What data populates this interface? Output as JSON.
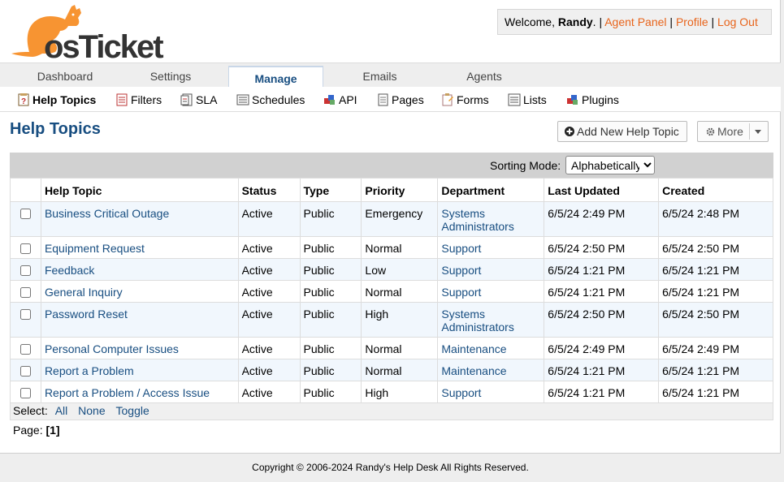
{
  "header": {
    "logo_text": "osTicket",
    "welcome_prefix": "Welcome, ",
    "user_name": "Randy",
    "welcome_suffix": ". |",
    "links": [
      "Agent Panel",
      "Profile",
      "Log Out"
    ],
    "separators": [
      "|",
      "|"
    ]
  },
  "nav": {
    "tabs": [
      "Dashboard",
      "Settings",
      "Manage",
      "Emails",
      "Agents"
    ],
    "active": "Manage"
  },
  "subnav": {
    "items": [
      "Help Topics",
      "Filters",
      "SLA",
      "Schedules",
      "API",
      "Pages",
      "Forms",
      "Lists",
      "Plugins"
    ],
    "active": "Help Topics"
  },
  "page": {
    "title": "Help Topics",
    "add_button": "Add New Help Topic",
    "more_button": "More",
    "sorting_label": "Sorting Mode:",
    "sorting_value": "Alphabetically"
  },
  "table": {
    "columns": [
      "Help Topic",
      "Status",
      "Type",
      "Priority",
      "Department",
      "Last Updated",
      "Created"
    ],
    "rows": [
      {
        "topic": "Business Critical Outage",
        "status": "Active",
        "type": "Public",
        "priority": "Emergency",
        "department": "Systems Administrators",
        "updated": "6/5/24 2:49 PM",
        "created": "6/5/24 2:48 PM"
      },
      {
        "topic": "Equipment Request",
        "status": "Active",
        "type": "Public",
        "priority": "Normal",
        "department": "Support",
        "updated": "6/5/24 2:50 PM",
        "created": "6/5/24 2:50 PM"
      },
      {
        "topic": "Feedback",
        "status": "Active",
        "type": "Public",
        "priority": "Low",
        "department": "Support",
        "updated": "6/5/24 1:21 PM",
        "created": "6/5/24 1:21 PM"
      },
      {
        "topic": "General Inquiry",
        "status": "Active",
        "type": "Public",
        "priority": "Normal",
        "department": "Support",
        "updated": "6/5/24 1:21 PM",
        "created": "6/5/24 1:21 PM"
      },
      {
        "topic": "Password Reset",
        "status": "Active",
        "type": "Public",
        "priority": "High",
        "department": "Systems Administrators",
        "updated": "6/5/24 2:50 PM",
        "created": "6/5/24 2:50 PM"
      },
      {
        "topic": "Personal Computer Issues",
        "status": "Active",
        "type": "Public",
        "priority": "Normal",
        "department": "Maintenance",
        "updated": "6/5/24 2:49 PM",
        "created": "6/5/24 2:49 PM"
      },
      {
        "topic": "Report a Problem",
        "status": "Active",
        "type": "Public",
        "priority": "Normal",
        "department": "Maintenance",
        "updated": "6/5/24 1:21 PM",
        "created": "6/5/24 1:21 PM"
      },
      {
        "topic": "Report a Problem / Access Issue",
        "status": "Active",
        "type": "Public",
        "priority": "High",
        "department": "Support",
        "updated": "6/5/24 1:21 PM",
        "created": "6/5/24 1:21 PM"
      }
    ]
  },
  "select": {
    "label": "Select:",
    "options": [
      "All",
      "None",
      "Toggle"
    ]
  },
  "pager": {
    "label": "Page:",
    "current": "[1]"
  },
  "footer": {
    "copyright": "Copyright © 2006-2024 Randy's Help Desk All Rights Reserved."
  },
  "colors": {
    "link": "#184e81",
    "header_link": "#e8641b",
    "logo": "#f79432",
    "row_highlight": "#f1f7fd"
  }
}
